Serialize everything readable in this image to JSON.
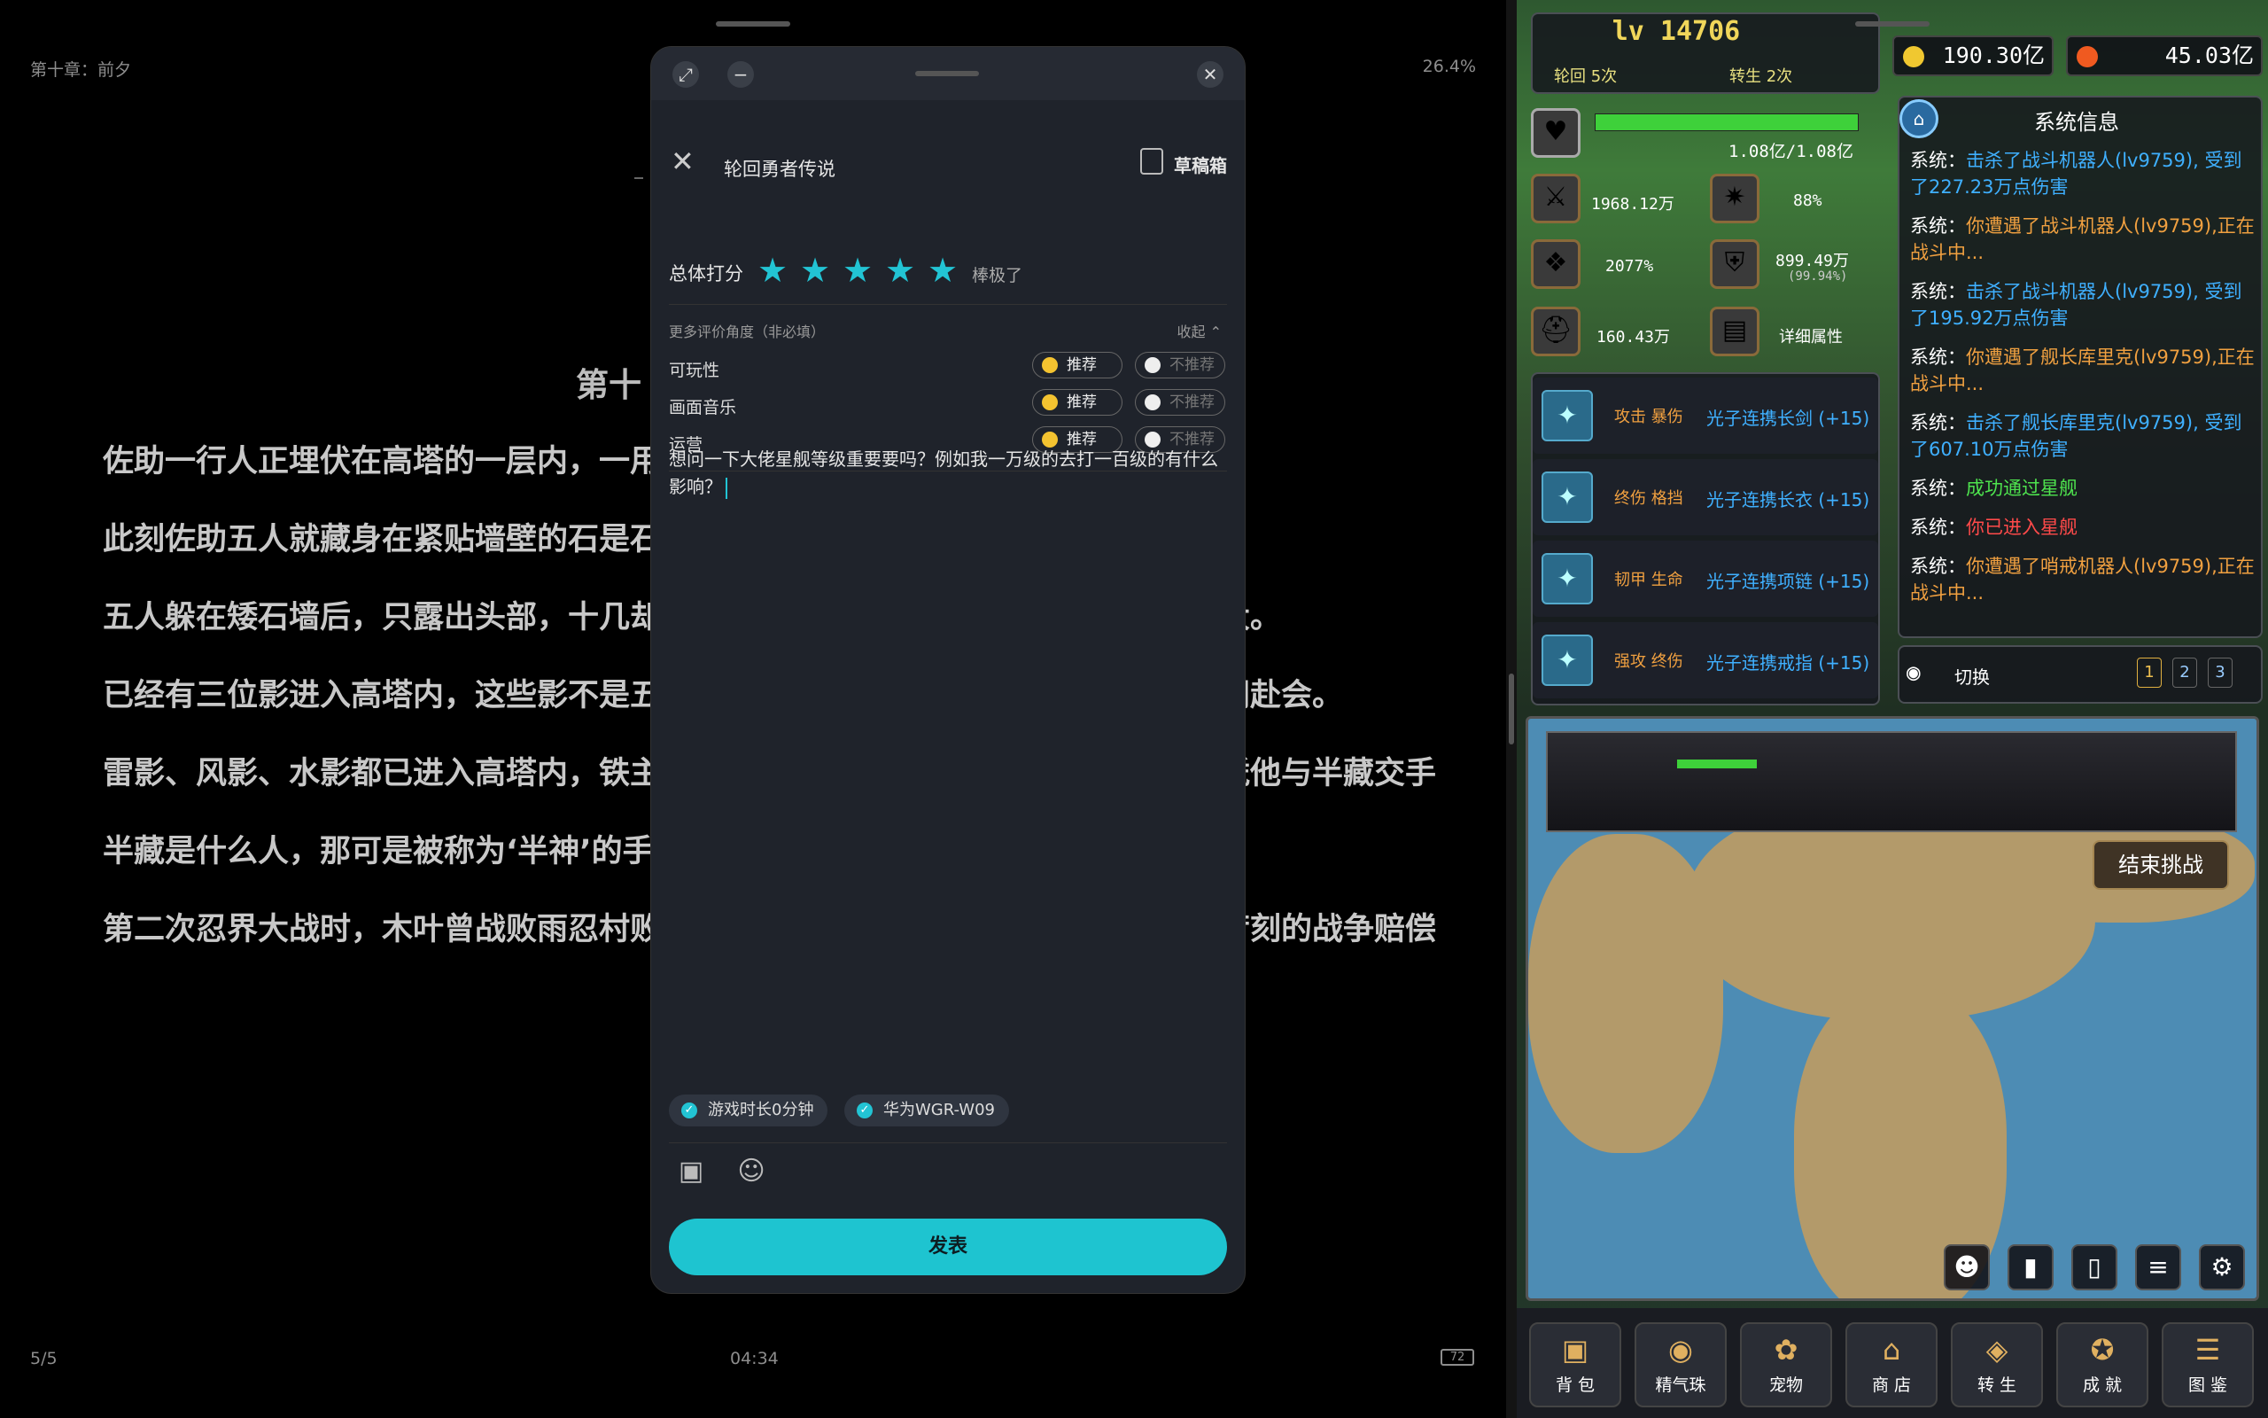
{
  "reader": {
    "chapter_label": "第十章：前夕",
    "progress": "26.4%",
    "heading": "第十",
    "paragraphs": [
      "佐助一行人正埋伏在高塔的一层内，一用于武士警戒或巡逻之用。",
      "此刻佐助五人就藏身在紧贴墙壁的石是石台上视野开阔。",
      "五人躲在矮石墙后，只露出头部，十几却型，这些武士能察觉到这几人的可能性不大。",
      "已经有三位影进入高塔内，这些影不是五影大会不成文的规定，最多带两名部下一同赴会。",
      "雷影、风影、水影都已进入高塔内，铁主持这场会议，三船在忍者中名气很高，单凭他与半藏交手",
      "半藏是什么人，那可是被称为‘半神’的手柱间。",
      "第二次忍界大战时，木叶曾战败雨忍村败了，首领半藏却没败，因此木叶没提出太苛刻的战争赔偿"
    ],
    "page": "5/5",
    "time": "04:34",
    "battery": "72"
  },
  "review": {
    "game_title": "轮回勇者传说",
    "draft_label": "草稿箱",
    "score_label": "总体打分",
    "rating": 5,
    "rating_word": "棒极了",
    "more_label": "更多评价角度（非必填）",
    "collapse_label": "收起 ⌃",
    "criteria": [
      {
        "name": "可玩性",
        "yes": "推荐",
        "no": "不推荐"
      },
      {
        "name": "画面音乐",
        "yes": "推荐",
        "no": "不推荐"
      },
      {
        "name": "运营",
        "yes": "推荐",
        "no": "不推荐"
      }
    ],
    "comment": "想问一下大佬星舰等级重要要吗？例如我一万级的去打一百级的有什么影响？",
    "tags": [
      "游戏时长0分钟",
      "华为WGR-W09"
    ],
    "post_label": "发表"
  },
  "game": {
    "level": "lv 14706",
    "reincarnation": "轮回 5次",
    "rebirth": "转生 2次",
    "gold": "190.30亿",
    "fire": "45.03亿",
    "hp_text": "1.08亿/1.08亿",
    "hp_fraction": 1.0,
    "stats": {
      "atk": "1968.12万",
      "crit": "88%",
      "s3": "2077%",
      "def": "899.49万",
      "def_pct": "(99.94%)",
      "s5": "160.43万",
      "detail": "详细属性"
    },
    "equipment": [
      {
        "type": "攻击 暴伤",
        "name": "光子连携长剑 (+15)"
      },
      {
        "type": "终伤 格挡",
        "name": "光子连携长衣 (+15)"
      },
      {
        "type": "韧甲 生命",
        "name": "光子连携项链 (+15)"
      },
      {
        "type": "强攻 终伤",
        "name": "光子连携戒指 (+15)"
      }
    ],
    "system_title": "系统信息",
    "log": [
      {
        "who": "系统：",
        "text": "击杀了战斗机器人(lv9759), 受到了227.23万点伤害",
        "kind": "kill"
      },
      {
        "who": "系统：",
        "text": "你遭遇了战斗机器人(lv9759),正在战斗中...",
        "kind": "meet"
      },
      {
        "who": "系统：",
        "text": "击杀了战斗机器人(lv9759), 受到了195.92万点伤害",
        "kind": "kill"
      },
      {
        "who": "系统：",
        "text": "你遭遇了舰长库里克(lv9759),正在战斗中...",
        "kind": "meet"
      },
      {
        "who": "系统：",
        "text": "击杀了舰长库里克(lv9759), 受到了607.10万点伤害",
        "kind": "kill"
      },
      {
        "who": "系统：",
        "text": "成功通过星舰",
        "kind": "ok"
      },
      {
        "who": "系统：",
        "text": "你已进入星舰",
        "kind": "enter"
      },
      {
        "who": "系统：",
        "text": "你遭遇了哨戒机器人(lv9759),正在战斗中...",
        "kind": "meet"
      }
    ],
    "switch_label": "切换",
    "pages": [
      "1",
      "2",
      "3"
    ],
    "end_btn": "结束挑战",
    "bottom_nav": [
      "背 包",
      "精气珠",
      "宠物",
      "商 店",
      "转 生",
      "成 就",
      "图 鉴"
    ]
  }
}
